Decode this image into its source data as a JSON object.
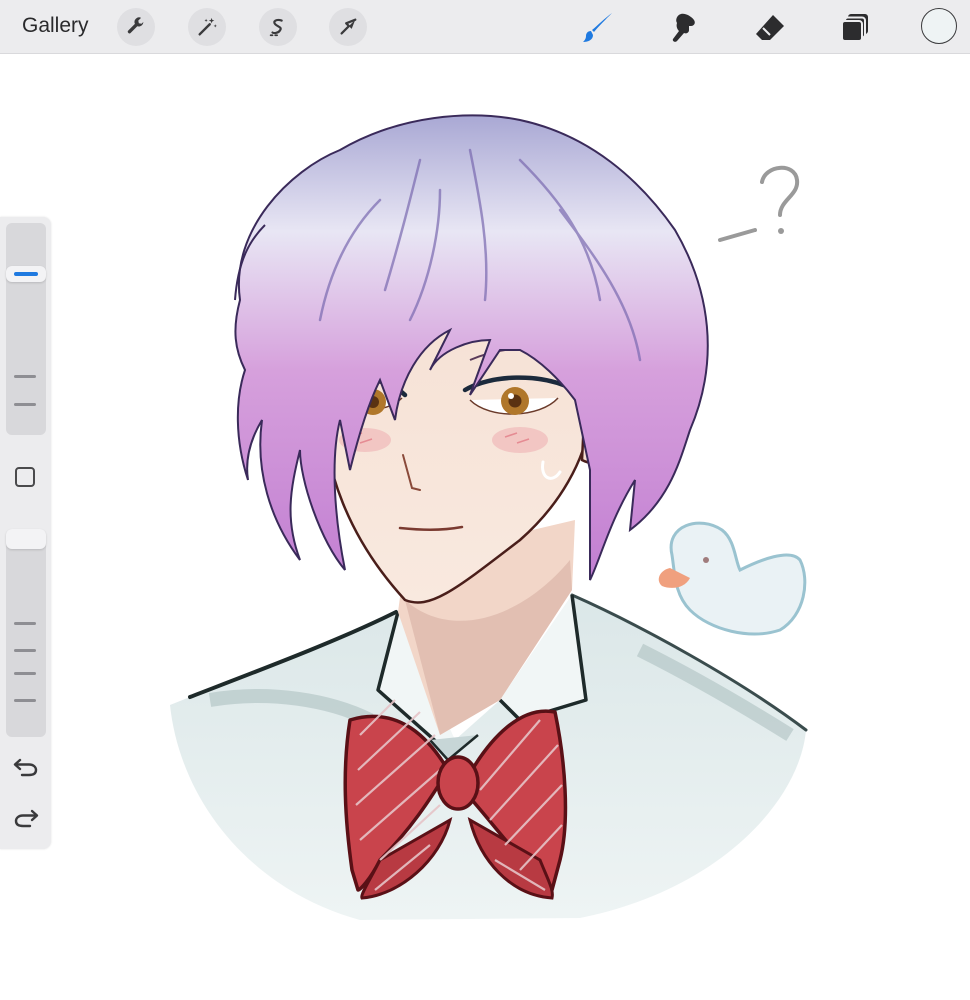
{
  "toolbar": {
    "gallery_label": "Gallery",
    "left_tools": [
      "wrench-icon",
      "magic-wand-icon",
      "selection-s-icon",
      "transform-arrow-icon"
    ],
    "right_tools": [
      "brush-icon",
      "smudge-icon",
      "eraser-icon",
      "layers-icon"
    ],
    "active_tool": "brush",
    "accent_color": "#1f7ae0",
    "current_color": "#eef3f4"
  },
  "sidebar": {
    "brush_size_level": 0.78,
    "opacity_level": 1.0,
    "icons": [
      "modify-square-icon",
      "undo-icon",
      "redo-icon"
    ]
  },
  "artwork": {
    "annotation": "_?"
  }
}
